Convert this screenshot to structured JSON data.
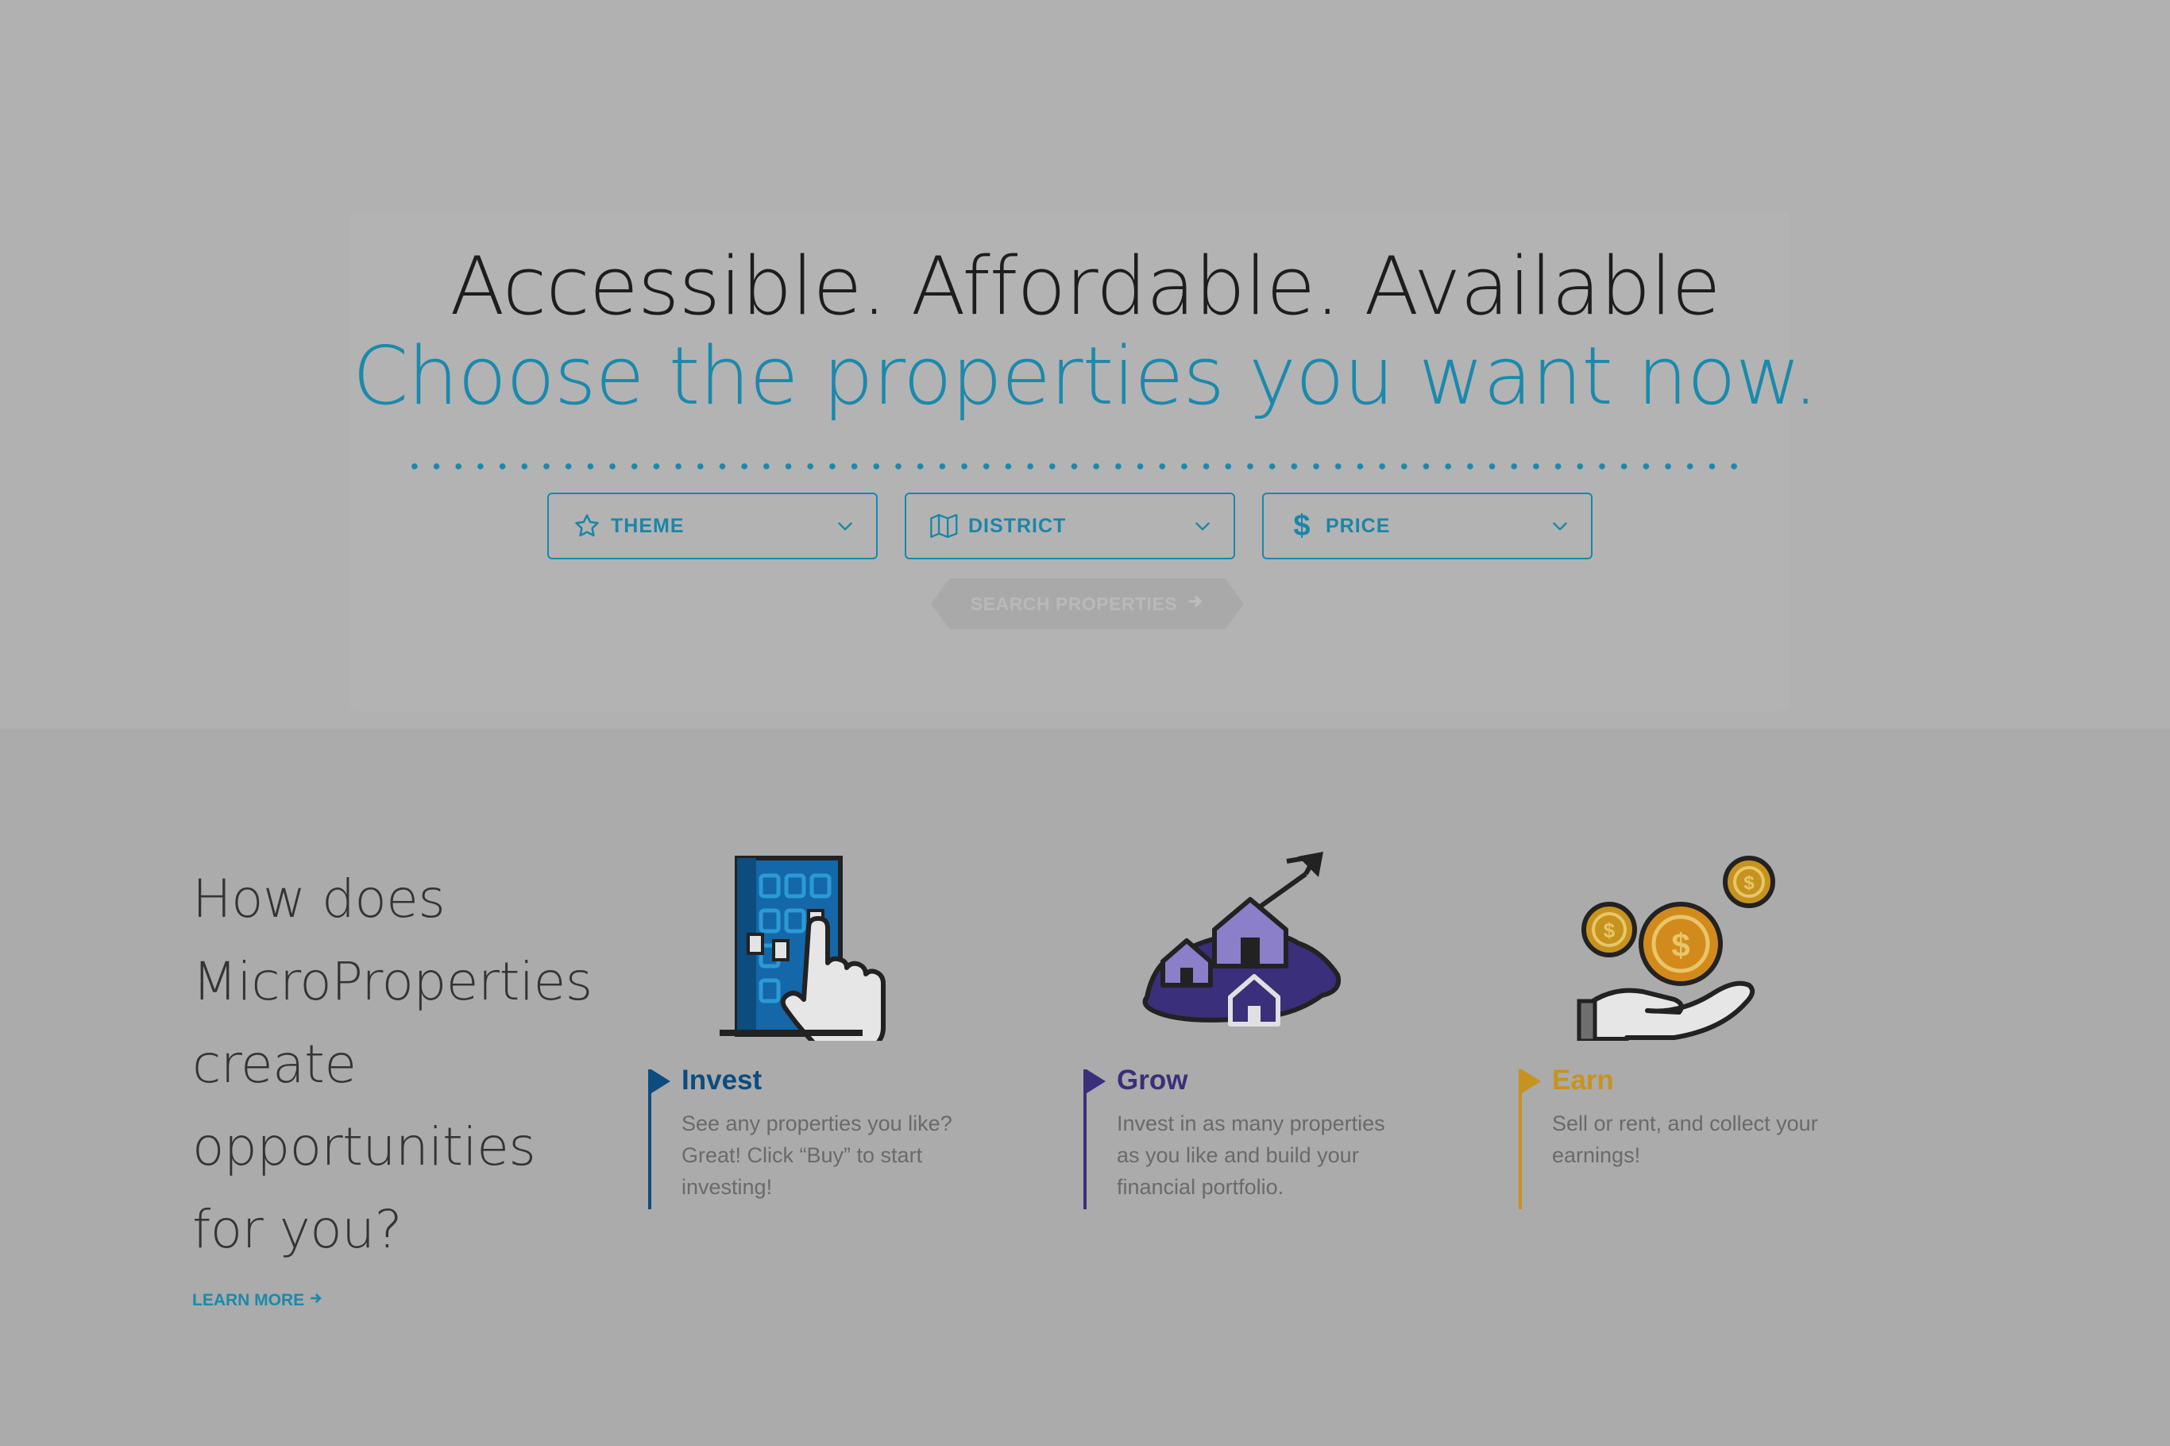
{
  "hero": {
    "headline": "Accessible. Affordable. Available",
    "subheadline": "Choose the properties you want now.",
    "filters": [
      {
        "label": "THEME",
        "icon": "star-icon"
      },
      {
        "label": "DISTRICT",
        "icon": "map-icon"
      },
      {
        "label": "PRICE",
        "icon": "dollar-icon"
      }
    ],
    "search_label": "SEARCH PROPERTIES",
    "accent_color": "#1b89ac"
  },
  "how": {
    "title": "How does MicroProperties create opportunities for you?",
    "learn_more": "LEARN MORE"
  },
  "features": [
    {
      "title": "Invest",
      "description": "See any properties you like? Great! Click “Buy” to start investing!",
      "color": "#0d4c7e",
      "icon": "building-tap-icon"
    },
    {
      "title": "Grow",
      "description": "Invest in as many properties as you like and build your financial portfolio.",
      "color": "#3a2f7a",
      "icon": "growth-houses-icon"
    },
    {
      "title": "Earn",
      "description": "Sell or rent, and collect your earnings!",
      "color": "#c7931f",
      "icon": "coins-hand-icon"
    }
  ]
}
